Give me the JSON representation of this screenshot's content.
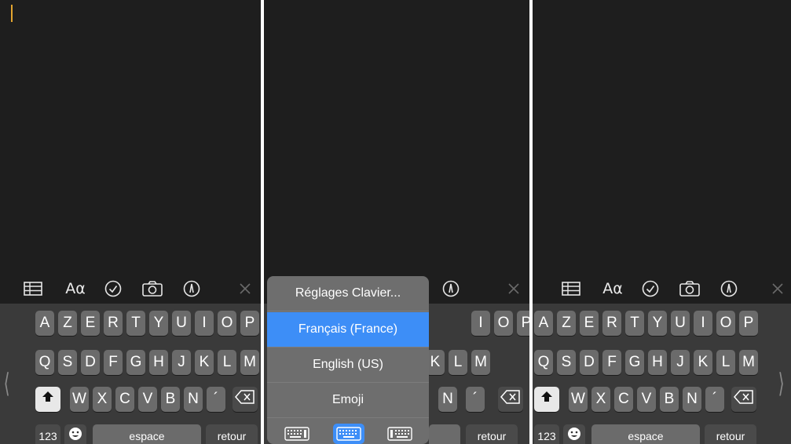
{
  "toolbar": {
    "icons": [
      "table-icon",
      "text-format-icon",
      "checklist-icon",
      "camera-icon",
      "markup-icon",
      "close-icon"
    ],
    "format_label": "Aα"
  },
  "keyboard": {
    "row1": [
      "A",
      "Z",
      "E",
      "R",
      "T",
      "Y",
      "U",
      "I",
      "O",
      "P"
    ],
    "row2": [
      "Q",
      "S",
      "D",
      "F",
      "G",
      "H",
      "J",
      "K",
      "L",
      "M"
    ],
    "row3": [
      "W",
      "X",
      "C",
      "V",
      "B",
      "N",
      "´"
    ],
    "numbers_label": "123",
    "space_label": "espace",
    "return_label": "retour"
  },
  "popup": {
    "settings_label": "Réglages Clavier...",
    "items": [
      "Français (France)",
      "English (US)",
      "Emoji"
    ],
    "selected": "Français (France)"
  },
  "colors": {
    "cursor": "#e3a52f",
    "selection": "#3d8ef7",
    "background": "#1e1e1e",
    "keyboard": "#3a3a3a"
  }
}
